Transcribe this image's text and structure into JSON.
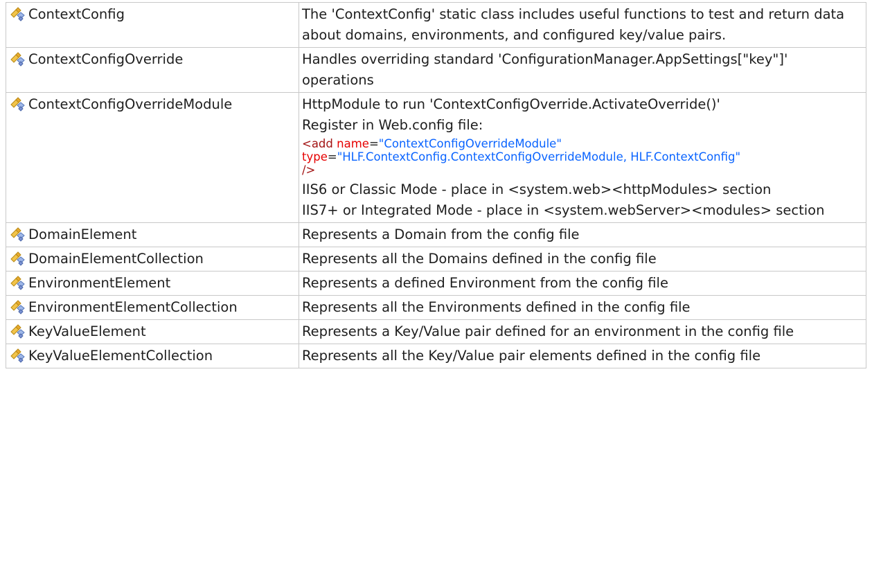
{
  "icon": "class-icon",
  "rows": [
    {
      "name": "ContextConfig",
      "desc": "The 'ContextConfig' static class includes useful functions to test and return data about domains, environments, and configured key/value pairs."
    },
    {
      "name": "ContextConfigOverride",
      "desc": "Handles overriding standard 'ConfigurationManager.AppSettings[\"key\"]' operations"
    },
    {
      "name": "ContextConfigOverrideModule",
      "desc_lines": [
        "HttpModule to run 'ContextConfigOverride.ActivateOverride()'",
        "Register in Web.config file:"
      ],
      "code": {
        "open": "<add ",
        "attr1": "name",
        "eq1": "=",
        "val1": "\"ContextConfigOverrideModule\"",
        "attr2": "type",
        "eq2": "=",
        "val2": "\"HLF.ContextConfig.ContextConfigOverrideModule, HLF.ContextConfig\"",
        "close": "/>"
      },
      "desc_after": [
        "IIS6 or Classic Mode - place in <system.web><httpModules> section",
        "IIS7+ or Integrated Mode - place in <system.webServer><modules> section"
      ]
    },
    {
      "name": "DomainElement",
      "desc": "Represents a Domain from the config file"
    },
    {
      "name": "DomainElementCollection",
      "desc": "Represents all the Domains defined in the config file"
    },
    {
      "name": "EnvironmentElement",
      "desc": "Represents a defined Environment from the config file"
    },
    {
      "name": "EnvironmentElementCollection",
      "desc": "Represents all the Environments defined in the config file"
    },
    {
      "name": "KeyValueElement",
      "desc": "Represents a Key/Value pair defined for an environment in the config file"
    },
    {
      "name": "KeyValueElementCollection",
      "desc": "Represents all the Key/Value pair elements defined in the config file"
    }
  ]
}
